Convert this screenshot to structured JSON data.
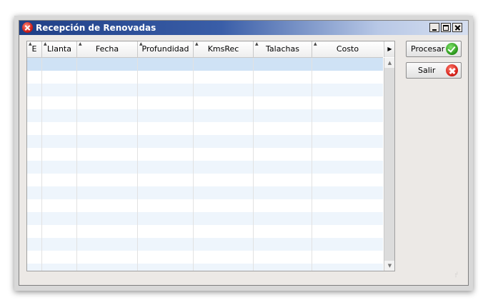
{
  "window": {
    "title": "Recepción de Renovadas"
  },
  "grid": {
    "columns": [
      {
        "label": "E"
      },
      {
        "label": "Llanta"
      },
      {
        "label": "Fecha"
      },
      {
        "label": "Profundidad"
      },
      {
        "label": "KmsRec"
      },
      {
        "label": "Talachas"
      },
      {
        "label": "Costo"
      }
    ],
    "selected_row": 0
  },
  "actions": {
    "procesar_label": "Procesar",
    "salir_label": "Salir"
  },
  "icons": {
    "app": "tools-icon",
    "procesar": "check-icon",
    "salir": "close-icon"
  },
  "colors": {
    "titlebar": "#1f3f86",
    "row_alt": "#eef5fc",
    "row_selected": "#cfe2f5",
    "ok": "#2e9a1e",
    "cancel": "#d4201a"
  }
}
